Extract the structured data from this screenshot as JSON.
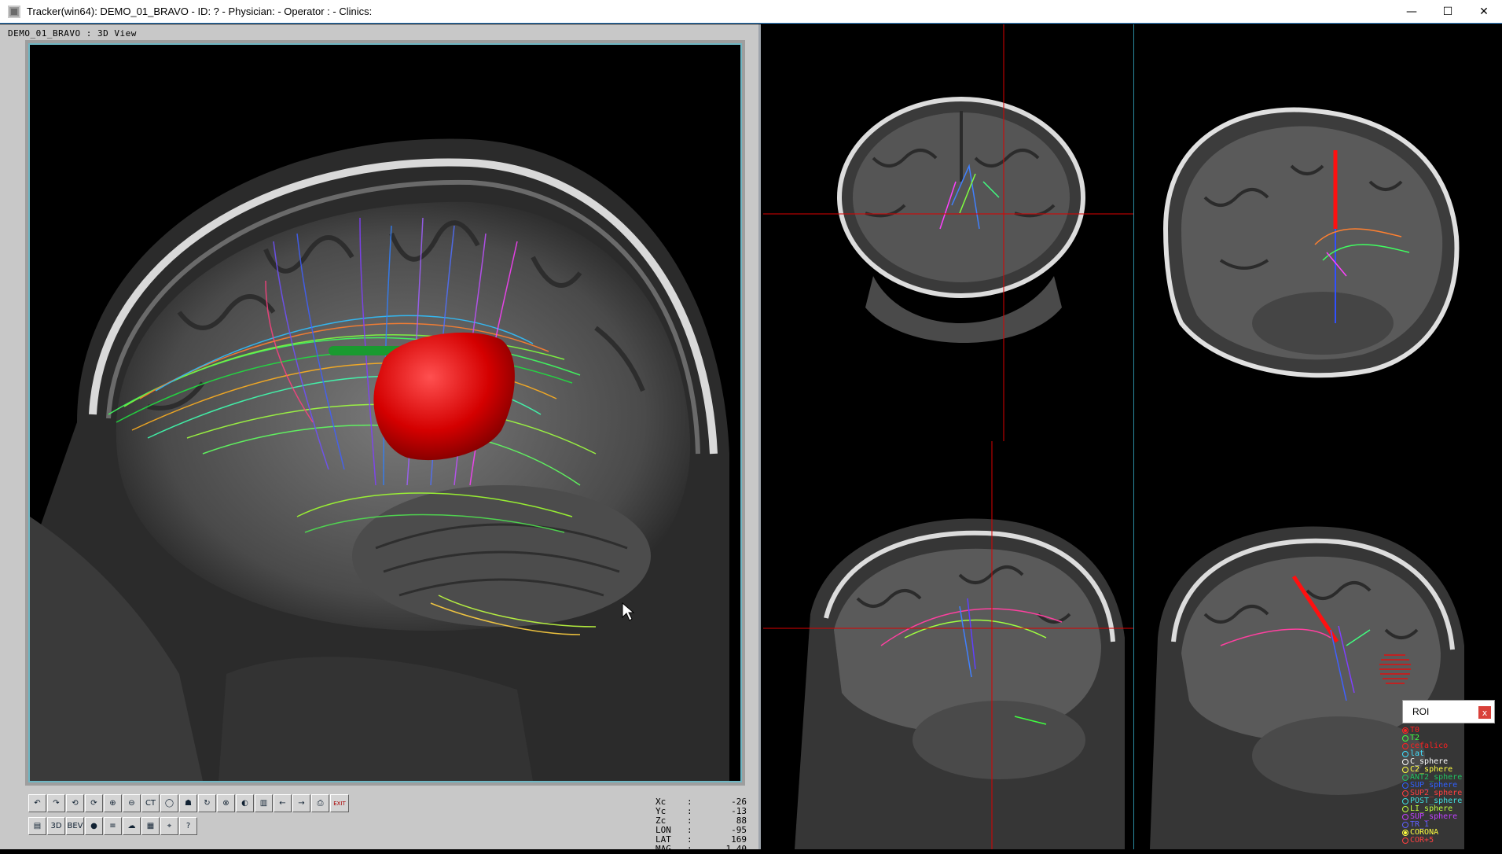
{
  "window": {
    "title": "Tracker(win64): DEMO_01_BRAVO - ID:  ? - Physician:  - Operator : - Clinics:",
    "minimize": "—",
    "maximize": "☐",
    "close": "✕"
  },
  "left_view": {
    "label": "DEMO_01_BRAVO : 3D View"
  },
  "toolbar": {
    "row1": [
      {
        "name": "undo-icon",
        "glyph": "↶"
      },
      {
        "name": "redo-icon",
        "glyph": "↷"
      },
      {
        "name": "rotate-left-icon",
        "glyph": "⟲"
      },
      {
        "name": "rotate-right-icon",
        "glyph": "⟳"
      },
      {
        "name": "zoom-in-icon",
        "glyph": "⊕"
      },
      {
        "name": "zoom-out-icon",
        "glyph": "⊖"
      },
      {
        "name": "ct-volume-icon",
        "glyph": "CT"
      },
      {
        "name": "head-outline-icon",
        "glyph": "◯"
      },
      {
        "name": "skull-icon",
        "glyph": "☗"
      },
      {
        "name": "rotate-head-icon",
        "glyph": "↻"
      },
      {
        "name": "cancel-icon",
        "glyph": "⊗"
      },
      {
        "name": "contrast-icon",
        "glyph": "◐"
      },
      {
        "name": "layers-icon",
        "glyph": "▥"
      },
      {
        "name": "arrow-left-icon",
        "glyph": "←"
      },
      {
        "name": "arrow-right-icon",
        "glyph": "→"
      },
      {
        "name": "print-icon",
        "glyph": "⎙"
      },
      {
        "name": "exit-icon",
        "glyph": "EXIT"
      }
    ],
    "row2": [
      {
        "name": "window-icon",
        "glyph": "▤"
      },
      {
        "name": "display-3d-icon",
        "glyph": "3D"
      },
      {
        "name": "bev-icon",
        "glyph": "BEV"
      },
      {
        "name": "record-icon",
        "glyph": "●"
      },
      {
        "name": "filter-icon",
        "glyph": "≡"
      },
      {
        "name": "brain-icon",
        "glyph": "☁"
      },
      {
        "name": "poi-calendar-icon",
        "glyph": "▦"
      },
      {
        "name": "crosshair-icon",
        "glyph": "⌖"
      },
      {
        "name": "help-icon",
        "glyph": "?"
      }
    ]
  },
  "coords": [
    {
      "key": "Xc",
      "value": "-26"
    },
    {
      "key": "Yc",
      "value": "-13"
    },
    {
      "key": "Zc",
      "value": "88"
    },
    {
      "key": "LON",
      "value": "-95"
    },
    {
      "key": "LAT",
      "value": "169"
    },
    {
      "key": "MAG",
      "value": "1.40"
    }
  ],
  "roi": {
    "title": "ROI",
    "close": "x",
    "items": [
      {
        "label": "T0",
        "color": "#ff2020",
        "on": true
      },
      {
        "label": "T2",
        "color": "#40ff40",
        "on": false
      },
      {
        "label": "cefalico",
        "color": "#ff2020",
        "on": false
      },
      {
        "label": "lat",
        "color": "#40e0ff",
        "on": false
      },
      {
        "label": "C_sphere",
        "color": "#ffffff",
        "on": false
      },
      {
        "label": "C2_sphere",
        "color": "#ffff40",
        "on": false
      },
      {
        "label": "ANT2_sphere",
        "color": "#20c060",
        "on": false
      },
      {
        "label": "SUP_sphere",
        "color": "#3060ff",
        "on": false
      },
      {
        "label": "SUP2_sphere",
        "color": "#ff4040",
        "on": false
      },
      {
        "label": "POST_sphere",
        "color": "#40e0e0",
        "on": false
      },
      {
        "label": "LI_sphere",
        "color": "#c0ff40",
        "on": false
      },
      {
        "label": "SUP_sphere",
        "color": "#c040ff",
        "on": false
      },
      {
        "label": "TR_1",
        "color": "#6060ff",
        "on": false
      },
      {
        "label": "CORONA",
        "color": "#ffff40",
        "on": true
      },
      {
        "label": "COR+5",
        "color": "#ff4040",
        "on": false
      }
    ]
  }
}
